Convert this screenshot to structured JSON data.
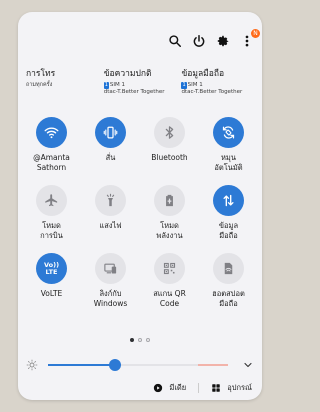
{
  "sim": {
    "calls_title": "การโทร",
    "calls_sub": "ถามทุกครั้ง",
    "messages_title": "ข้อความปกติ",
    "messages_sim": "SIM 1",
    "messages_sub2": "dtac-T.Better Together",
    "data_title": "ข้อมูลมือถือ",
    "data_sim": "SIM 1",
    "data_sub2": "dtac-T.Better Together"
  },
  "notification_badge": "N",
  "tiles": [
    {
      "name": "wifi",
      "line1": "@Amanta",
      "line2": "Sathorn",
      "on": true
    },
    {
      "name": "vibrate",
      "line1": "สั่น",
      "line2": "",
      "on": true
    },
    {
      "name": "bluetooth",
      "line1": "Bluetooth",
      "line2": "",
      "on": false
    },
    {
      "name": "auto-rotate",
      "line1": "หมุน",
      "line2": "อัตโนมัติ",
      "on": true
    },
    {
      "name": "airplane",
      "line1": "โหมด",
      "line2": "การบิน",
      "on": false
    },
    {
      "name": "flashlight",
      "line1": "แสงไฟ",
      "line2": "",
      "on": false
    },
    {
      "name": "power-saving",
      "line1": "โหมด",
      "line2": "พลังงาน",
      "on": false
    },
    {
      "name": "mobile-data",
      "line1": "ข้อมูล",
      "line2": "มือถือ",
      "on": true
    },
    {
      "name": "volte",
      "line1": "VoLTE",
      "line2": "",
      "on": true
    },
    {
      "name": "link-to-windows",
      "line1": "ลิงก์กับ",
      "line2": "Windows",
      "on": false
    },
    {
      "name": "qr-scanner",
      "line1": "สแกน QR",
      "line2": "Code",
      "on": false
    },
    {
      "name": "hotspot",
      "line1": "ฮอตสปอต",
      "line2": "มือถือ",
      "on": false
    }
  ],
  "volte_icon_text": {
    "line1": "Vo))",
    "line2": "LTE"
  },
  "brightness_level": 0.37,
  "bottom": {
    "media_label": "มีเดีย",
    "devices_label": "อุปกรณ์"
  },
  "colors": {
    "accent": "#2d7ad5",
    "tile_off": "#e3e3e7",
    "badge": "#ff6b1a"
  },
  "pages": {
    "count": 3,
    "active": 0
  }
}
